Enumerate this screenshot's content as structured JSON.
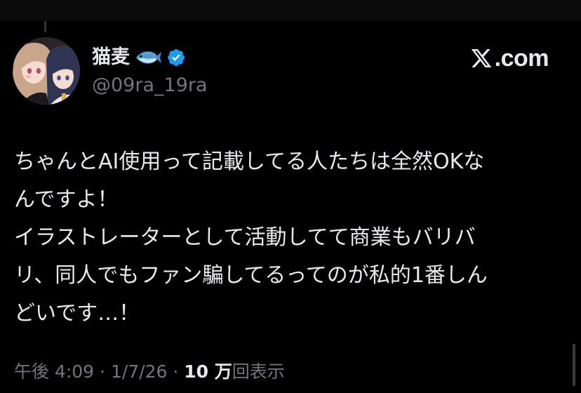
{
  "colors": {
    "background": "#000000",
    "text": "#e7e9ea",
    "muted": "#71767b",
    "verified": "#1d9bf0"
  },
  "author": {
    "display_name": "猫麦",
    "name_icons": [
      "fish-icon",
      "verified-badge-icon"
    ],
    "handle": "@09ra_19ra"
  },
  "brand": {
    "icon": "x-logo-icon",
    "text": ".com"
  },
  "tweet": {
    "lines": [
      "ちゃんとAI使用って記載してる人たちは全然OKな",
      "んですよ！",
      "イラストレーターとして活動してて商業もバリバ",
      "リ、同人でもファン騙してるってのが私的1番しん",
      "どいです…！"
    ]
  },
  "meta": {
    "time": "午後 4:09",
    "sep1": " · ",
    "date": "1/7/26",
    "sep2": " · ",
    "views": "10 万",
    "views_label": "回表示"
  }
}
